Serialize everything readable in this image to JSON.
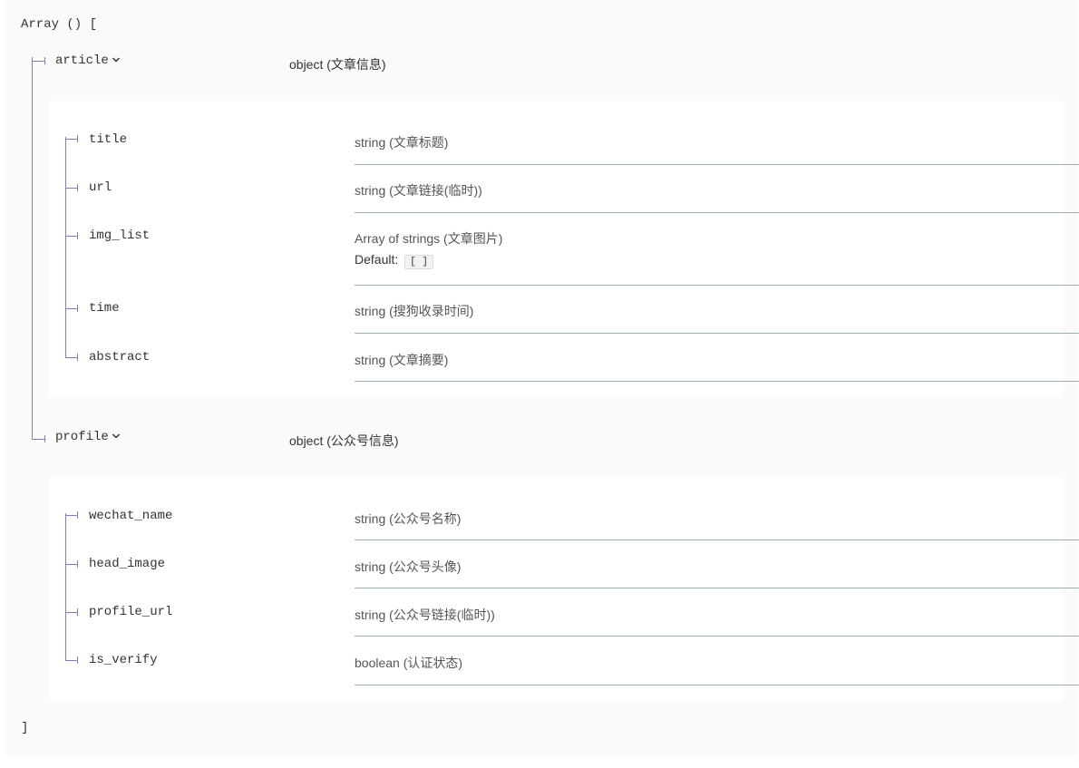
{
  "schema": {
    "open_bracket": "Array () [",
    "close_bracket": "]",
    "article": {
      "name": "article",
      "type": "object (文章信息)",
      "fields": [
        {
          "name": "title",
          "type": "string (文章标题)"
        },
        {
          "name": "url",
          "type": "string (文章链接(临时))"
        },
        {
          "name": "img_list",
          "type": "Array of strings (文章图片)",
          "default_label": "Default:",
          "default_value": "[ ]"
        },
        {
          "name": "time",
          "type": "string (搜狗收录时间)"
        },
        {
          "name": "abstract",
          "type": "string (文章摘要)"
        }
      ]
    },
    "profile": {
      "name": "profile",
      "type": "object (公众号信息)",
      "fields": [
        {
          "name": "wechat_name",
          "type": "string (公众号名称)"
        },
        {
          "name": "head_image",
          "type": "string (公众号头像)"
        },
        {
          "name": "profile_url",
          "type": "string (公众号链接(临时))"
        },
        {
          "name": "is_verify",
          "type": "boolean (认证状态)"
        }
      ]
    }
  },
  "icons": {
    "expand": "chevron-down-icon"
  },
  "colors": {
    "tree_line": "#7d7dc1",
    "separator": "#9bb0b4",
    "background": "#fafafa",
    "panel": "#ffffff"
  }
}
